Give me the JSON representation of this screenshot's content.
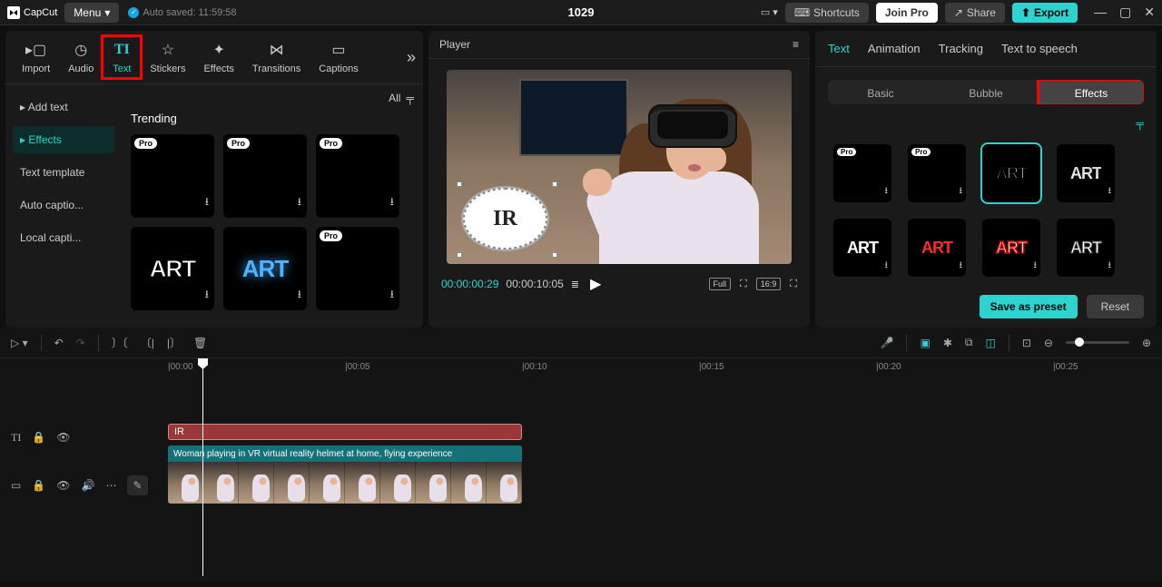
{
  "titlebar": {
    "app": "CapCut",
    "menu": "Menu",
    "autosave": "Auto saved: 11:59:58",
    "project": "1029",
    "shortcuts": "Shortcuts",
    "joinpro": "Join Pro",
    "share": "Share",
    "export": "Export"
  },
  "top_tabs": [
    "Import",
    "Audio",
    "Text",
    "Stickers",
    "Effects",
    "Transitions",
    "Captions"
  ],
  "top_tabs_selected": "Text",
  "sidebar": {
    "items": [
      "Add text",
      "Effects",
      "Text template",
      "Auto captio...",
      "Local capti..."
    ],
    "selected": "Effects"
  },
  "assets": {
    "filter": "All",
    "heading": "Trending",
    "art_label": "ART",
    "pro": "Pro"
  },
  "player": {
    "title": "Player",
    "bubble_text": "IR",
    "time_current": "00:00:00:29",
    "time_total": "00:00:10:05",
    "ratio": "16:9",
    "full": "Full"
  },
  "right": {
    "tabs": [
      "Text",
      "Animation",
      "Tracking",
      "Text to speech"
    ],
    "selected": "Text",
    "subtabs": [
      "Basic",
      "Bubble",
      "Effects"
    ],
    "sub_selected": "Effects",
    "art": "ART",
    "save_preset": "Save as preset",
    "reset": "Reset",
    "pro": "Pro"
  },
  "timeline": {
    "marks": [
      "|00:00",
      "|00:05",
      "|00:10",
      "|00:15",
      "|00:20",
      "|00:25"
    ],
    "text_clip": "IR",
    "video_clip": "Woman playing in VR virtual reality helmet at home, flying experience"
  }
}
